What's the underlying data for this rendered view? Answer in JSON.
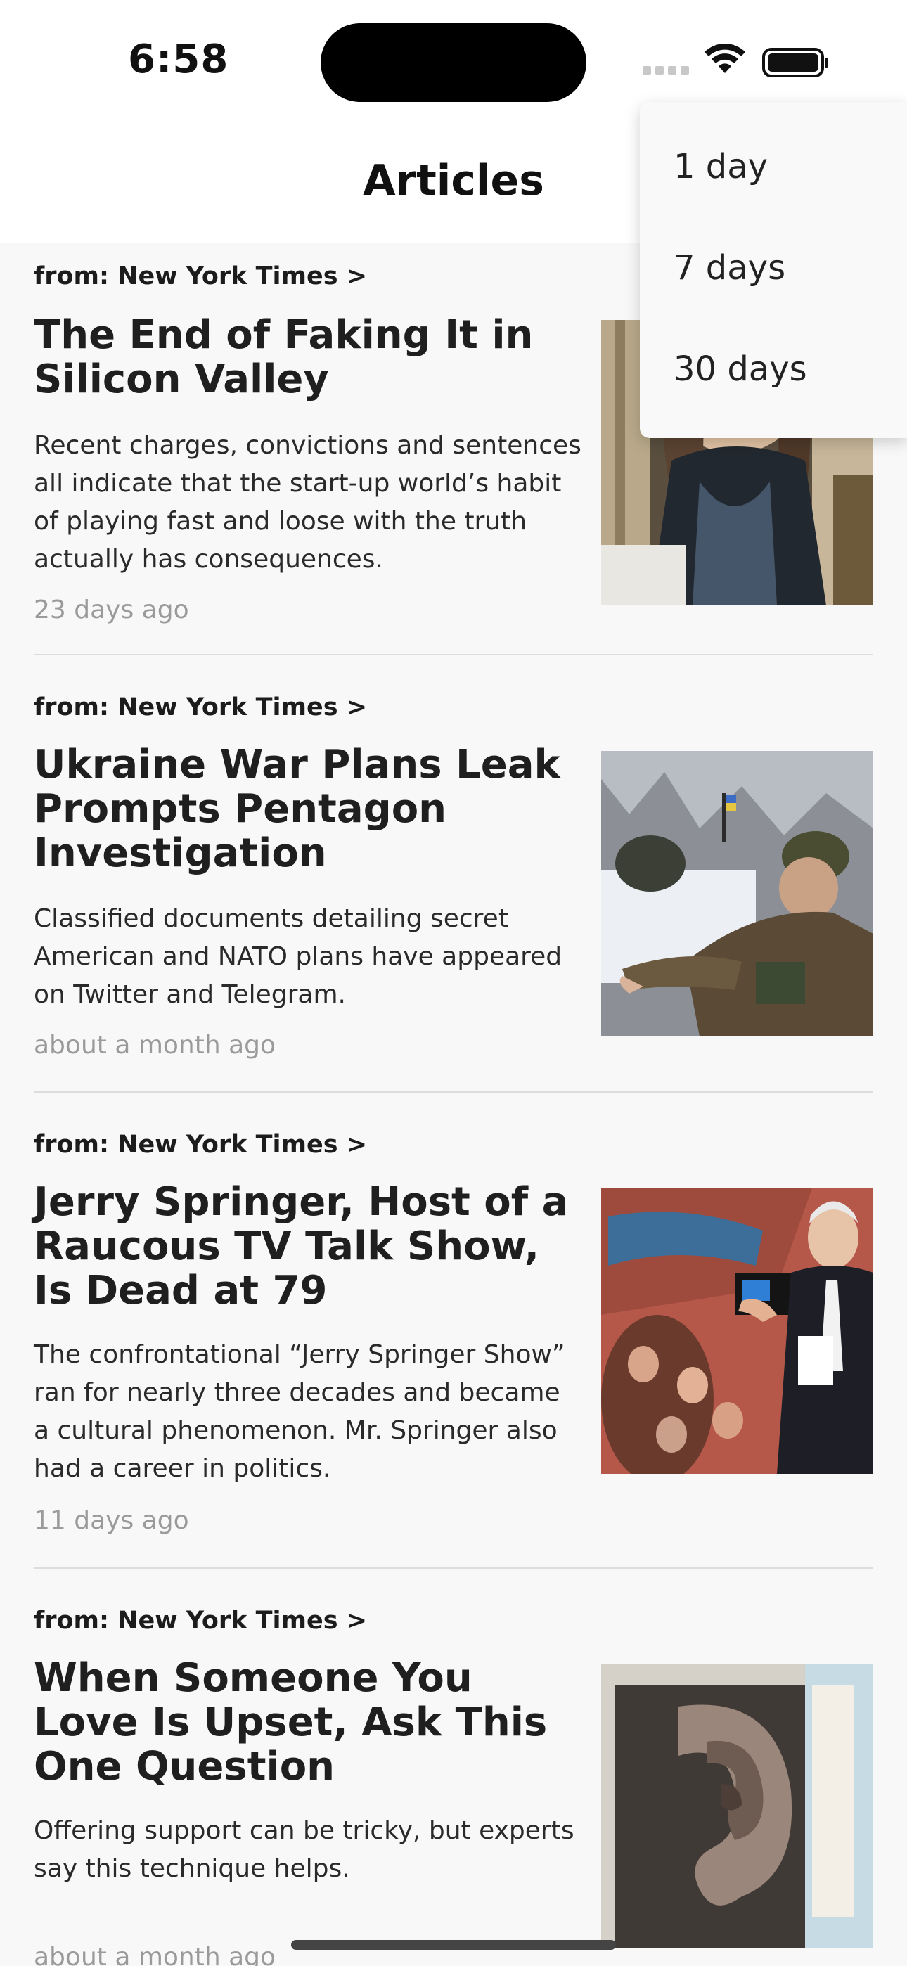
{
  "status_bar": {
    "time": "6:58"
  },
  "nav": {
    "title": "Articles"
  },
  "dropdown": {
    "options": [
      "1 day",
      "7 days",
      "30 days"
    ]
  },
  "articles": [
    {
      "source": "from: New York Times >",
      "title": "The End of Faking It in Silicon Valley",
      "summary": "Recent charges, convictions and sentences all indicate that the start-up world’s habit of playing fast and loose with the truth actually has consequences.",
      "age": "23 days ago"
    },
    {
      "source": "from: New York Times >",
      "title": "Ukraine War Plans Leak Prompts Pentagon Investigation",
      "summary": "Classified documents detailing secret American and NATO plans have appeared on Twitter and Telegram.",
      "age": "about a month ago"
    },
    {
      "source": "from: New York Times >",
      "title": "Jerry Springer, Host of a Raucous TV Talk Show, Is Dead at 79",
      "summary": "The confrontational “Jerry Springer Show” ran for nearly three decades and became a cultural phenomenon. Mr. Springer also had a career in politics.",
      "age": "11 days ago"
    },
    {
      "source": "from: New York Times >",
      "title": "When Someone You Love Is Upset, Ask This One Question",
      "summary": "Offering support can be tricky, but experts say this technique helps.",
      "age": "about a month ago"
    }
  ]
}
